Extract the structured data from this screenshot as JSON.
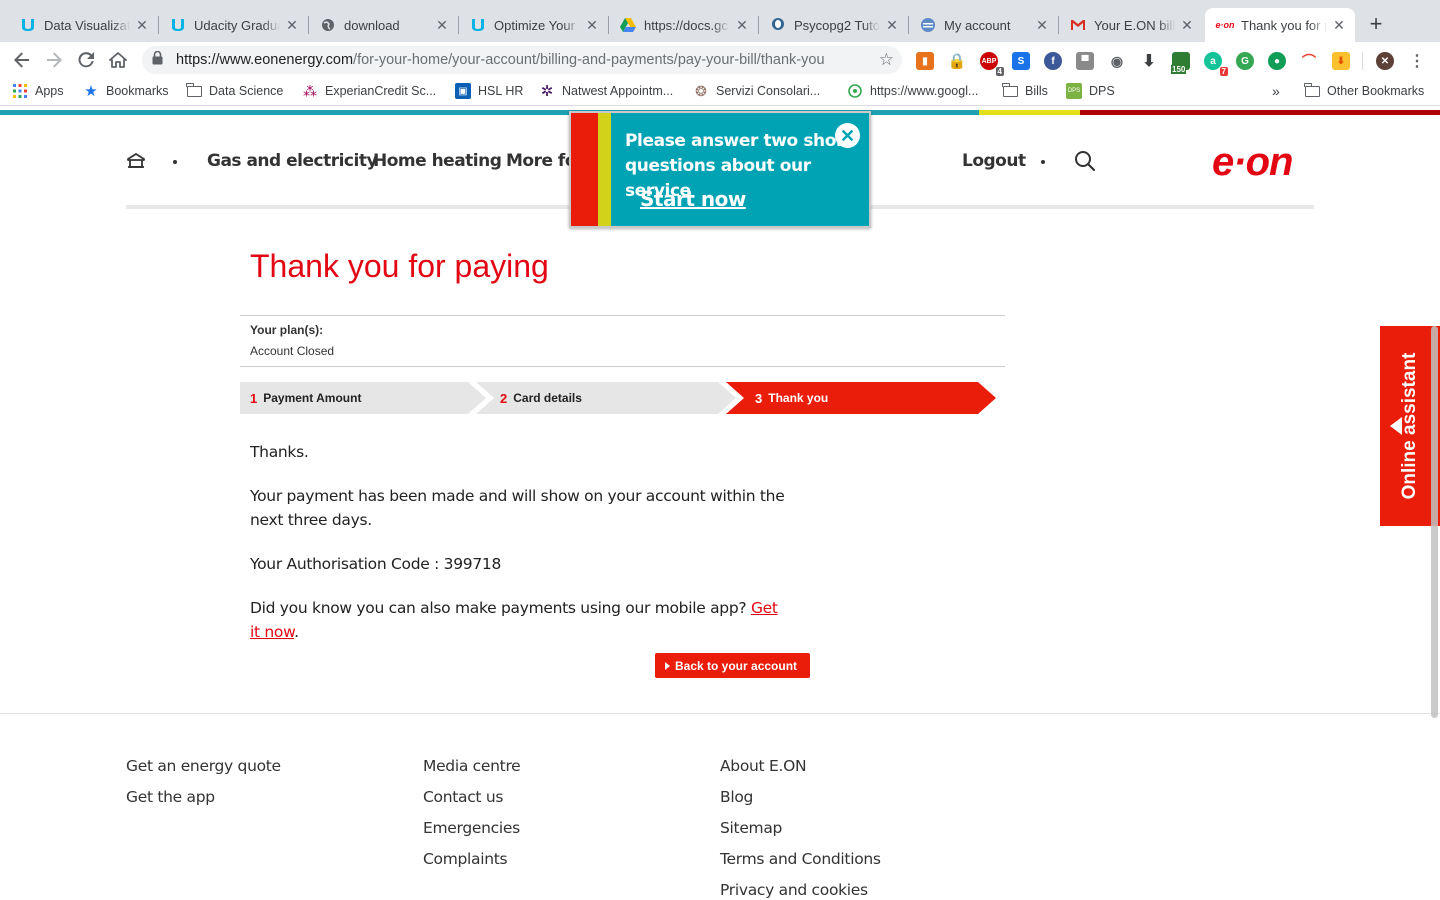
{
  "browser": {
    "tabs": [
      {
        "title": "Data Visualizati",
        "favicon": "udacity-icon",
        "active": false
      },
      {
        "title": "Udacity Gradua",
        "favicon": "udacity-icon",
        "active": false
      },
      {
        "title": "download",
        "favicon": "globe-icon",
        "active": false
      },
      {
        "title": "Optimize Your",
        "favicon": "udacity-icon",
        "active": false
      },
      {
        "title": "https://docs.gc",
        "favicon": "google-drive-icon",
        "active": false
      },
      {
        "title": "Psycopg2 Tuto",
        "favicon": "postgres-icon",
        "active": false
      },
      {
        "title": "My account",
        "favicon": "account-icon",
        "active": false
      },
      {
        "title": "Your E.ON bill",
        "favicon": "gmail-icon",
        "active": false
      },
      {
        "title": "Thank you for p",
        "favicon": "eon-icon",
        "active": true
      }
    ],
    "url_host": "https://www.eonenergy.com",
    "url_path": "/for-your-home/your-account/billing-and-payments/pay-your-bill/thank-you",
    "extension_badges": {
      "abp": "4",
      "score": "150",
      "grammar": "7"
    },
    "bookmarks": [
      {
        "label": "Apps",
        "icon": "apps-grid-icon"
      },
      {
        "label": "Bookmarks",
        "icon": "star-icon"
      },
      {
        "label": "Data Science",
        "icon": "folder-icon"
      },
      {
        "label": "ExperianCredit Sc...",
        "icon": "experian-icon"
      },
      {
        "label": "HSL HR",
        "icon": "hsl-icon"
      },
      {
        "label": "Natwest Appointm...",
        "icon": "natwest-icon"
      },
      {
        "label": "Servizi Consolari...",
        "icon": "consolari-icon"
      },
      {
        "label": "https://www.googl...",
        "icon": "google-icon"
      },
      {
        "label": "Bills",
        "icon": "folder-icon"
      },
      {
        "label": "DPS",
        "icon": "dps-icon"
      }
    ],
    "overflow": "»",
    "other_bookmarks": "Other Bookmarks"
  },
  "header": {
    "nav": [
      "Gas and electricity",
      "Home heating",
      "More for"
    ],
    "logout": "Logout",
    "logo": "e·on"
  },
  "survey": {
    "question": "Please answer two short questions about our service",
    "cta": "Start now"
  },
  "main": {
    "title": "Thank you for paying",
    "plan_label": "Your plan(s):",
    "plan_value": "Account Closed",
    "steps": [
      {
        "num": "1",
        "label": "Payment Amount",
        "active": false
      },
      {
        "num": "2",
        "label": "Card details",
        "active": false
      },
      {
        "num": "3",
        "label": "Thank you",
        "active": true
      }
    ],
    "thanks": "Thanks.",
    "payment_msg": "Your payment has been made and will show on your account within the next three days.",
    "auth_code_label": "Your Authorisation Code : 399718",
    "app_msg": "Did you know you can also make payments using our mobile app?",
    "app_link": "Get it now",
    "app_msg_end": ".",
    "back_button": "Back to your account"
  },
  "footer": {
    "col1": [
      "Get an energy quote",
      "Get the app"
    ],
    "col2": [
      "Media centre",
      "Contact us",
      "Emergencies",
      "Complaints"
    ],
    "col3": [
      "About E.ON",
      "Blog",
      "Sitemap",
      "Terms and Conditions",
      "Privacy and cookies"
    ]
  },
  "assistant": {
    "label": "Online assistant"
  },
  "colors": {
    "brand_red": "#e30613",
    "survey_teal": "#00a3b4",
    "accent_yellow": "#d3d21a"
  }
}
